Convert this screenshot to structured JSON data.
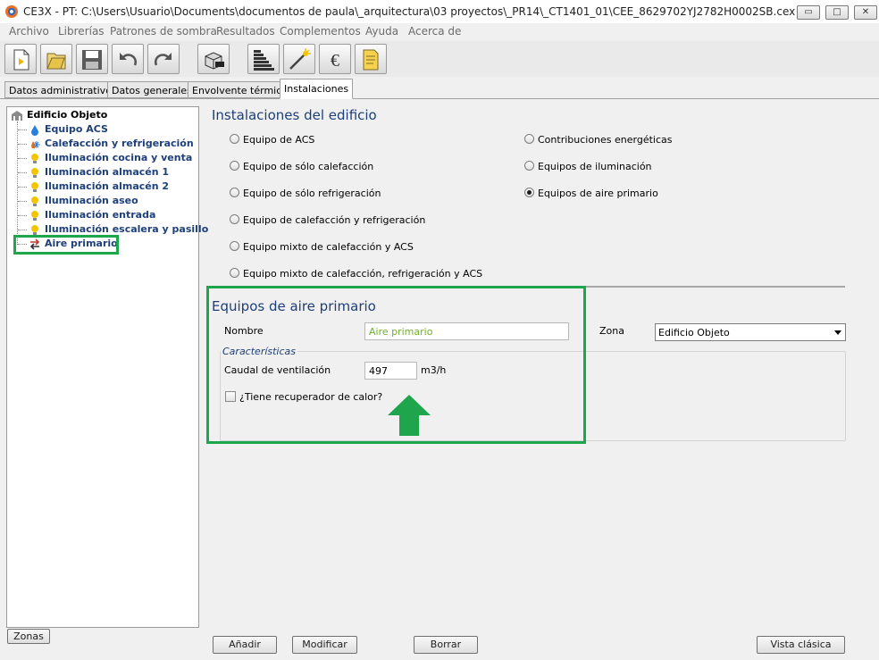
{
  "window": {
    "title": "CE3X - PT: C:\\Users\\Usuario\\Documents\\documentos de paula\\_arquitectura\\03 proyectos\\_PR14\\_CT1401_01\\CEE_8629702YJ2782H0002SB.cex",
    "controls": {
      "minimize": "▭",
      "maximize": "□",
      "close": "✕"
    }
  },
  "menu": [
    "Archivo",
    "Librerías",
    "Patrones de sombra",
    "Resultados",
    "Complementos",
    "Ayuda",
    "Acerca de"
  ],
  "toolbar": {
    "buttons": [
      "new-file-icon",
      "open-file-icon",
      "save-icon",
      "undo-icon",
      "redo-icon",
      "building-3d-icon",
      "energy-rating-icon",
      "improvement-measures-icon",
      "euro-icon",
      "document-icon"
    ]
  },
  "tabs": [
    "Datos administrativos",
    "Datos generales",
    "Envolvente térmica",
    "Instalaciones"
  ],
  "tree": {
    "root": "Edificio Objeto",
    "items": [
      {
        "label": "Equipo ACS",
        "icon": "water-drop-icon"
      },
      {
        "label": "Calefacción y refrigeración",
        "icon": "flame-snowflake-icon"
      },
      {
        "label": "Iluminación cocina y venta",
        "icon": "lightbulb-icon"
      },
      {
        "label": "Iluminación almacén 1",
        "icon": "lightbulb-icon"
      },
      {
        "label": "Iluminación almacén 2",
        "icon": "lightbulb-icon"
      },
      {
        "label": "Iluminación aseo",
        "icon": "lightbulb-icon"
      },
      {
        "label": "Iluminación entrada",
        "icon": "lightbulb-icon"
      },
      {
        "label": "Iluminación escalera y pasillo",
        "icon": "lightbulb-icon"
      },
      {
        "label": "Aire primario",
        "icon": "air-flow-arrows-icon"
      }
    ]
  },
  "zonas_button": "Zonas",
  "installations": {
    "title": "Instalaciones del edificio",
    "options_left": [
      "Equipo de ACS",
      "Equipo de sólo calefacción",
      "Equipo de sólo refrigeración",
      "Equipo de calefacción y refrigeración",
      "Equipo mixto de calefacción y ACS",
      "Equipo mixto de calefacción, refrigeración y ACS"
    ],
    "options_right": [
      "Contribuciones energéticas",
      "Equipos de iluminación",
      "Equipos de aire primario"
    ],
    "selected": "Equipos de aire primario"
  },
  "form": {
    "title": "Equipos de aire primario",
    "nombre_label": "Nombre",
    "nombre_value": "Aire primario",
    "zona_label": "Zona",
    "zona_value": "Edificio Objeto",
    "characteristics_legend": "Características",
    "caudal_label": "Caudal de ventilación",
    "caudal_value": "497",
    "caudal_unit": "m3/h",
    "recuperador_label": "¿Tiene recuperador de calor?",
    "recuperador_checked": false
  },
  "annotations": {
    "highlight_color": "#1fa54b"
  },
  "buttons": {
    "add": "Añadir",
    "modify": "Modificar",
    "delete": "Borrar",
    "classic_view": "Vista clásica"
  }
}
